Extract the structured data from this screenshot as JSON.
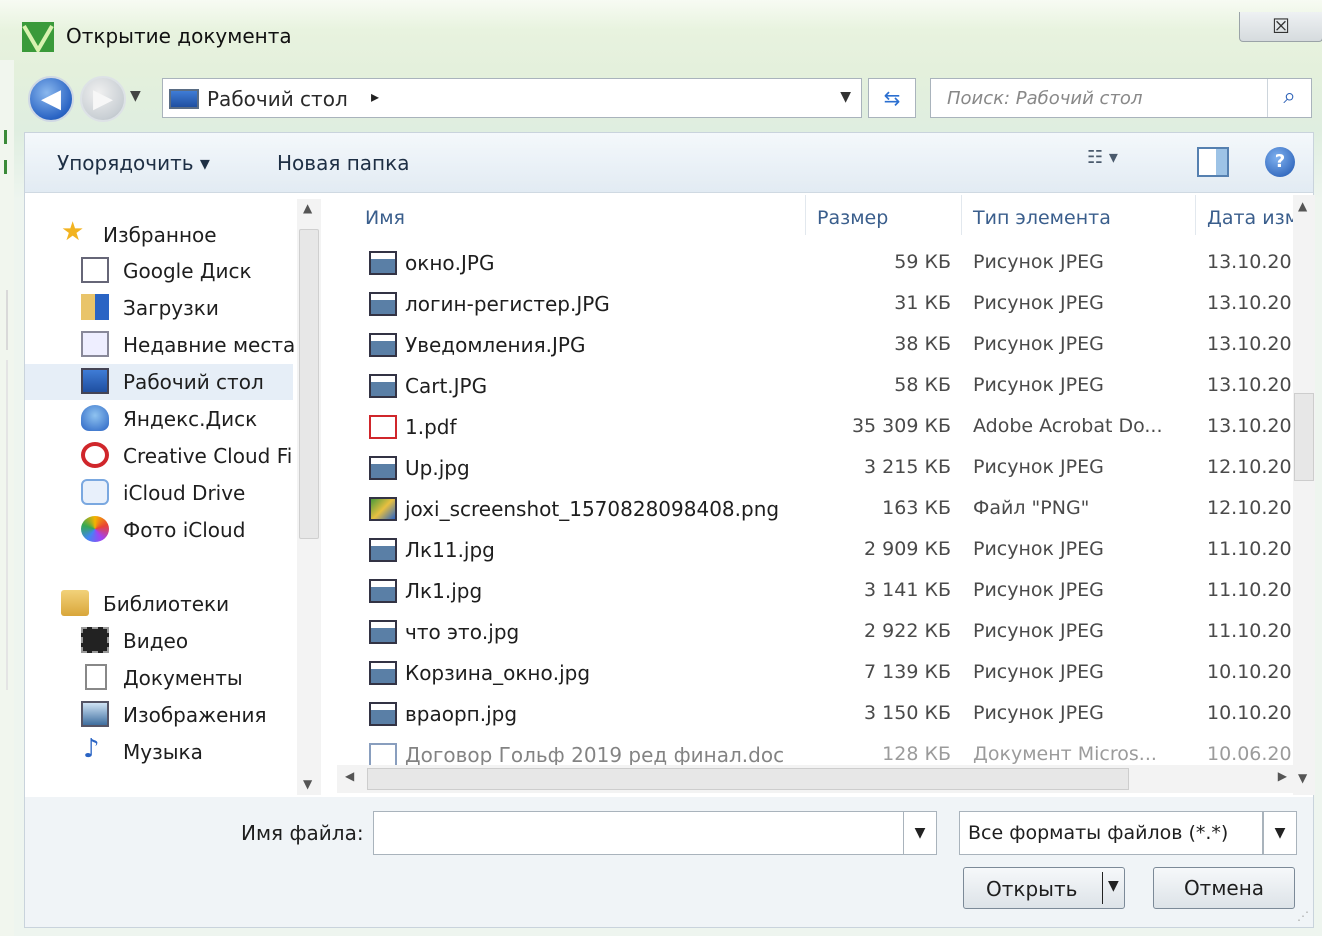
{
  "window": {
    "title": "Открытие документа",
    "close_glyph": "☒"
  },
  "nav": {
    "back_icon": "back-arrow-icon",
    "forward_icon": "forward-arrow-icon",
    "location": "Рабочий стол",
    "location_chevron": "▸",
    "search_placeholder": "Поиск: Рабочий стол"
  },
  "toolbar": {
    "organize_label": "Упорядочить ▾",
    "new_folder_label": "Новая папка",
    "view_glyph": "☷ ▾",
    "help_glyph": "?"
  },
  "sidebar": {
    "favorites_label": "Избранное",
    "items": [
      {
        "label": "Google Диск",
        "icon": "google-drive-icon"
      },
      {
        "label": "Загрузки",
        "icon": "downloads-icon"
      },
      {
        "label": "Недавние места",
        "icon": "recent-places-icon"
      },
      {
        "label": "Рабочий стол",
        "icon": "desktop-icon",
        "selected": true
      },
      {
        "label": "Яндекс.Диск",
        "icon": "yandex-disk-icon"
      },
      {
        "label": "Creative Cloud Fi",
        "icon": "creative-cloud-icon"
      },
      {
        "label": "iCloud Drive",
        "icon": "icloud-drive-icon"
      },
      {
        "label": "Фото iCloud",
        "icon": "icloud-photos-icon"
      }
    ],
    "libraries_label": "Библиотеки",
    "library_items": [
      {
        "label": "Видео",
        "icon": "video-icon"
      },
      {
        "label": "Документы",
        "icon": "documents-icon"
      },
      {
        "label": "Изображения",
        "icon": "pictures-icon"
      },
      {
        "label": "Музыка",
        "icon": "music-icon"
      }
    ]
  },
  "columns": {
    "name": "Имя",
    "size": "Размер",
    "type": "Тип элемента",
    "date": "Дата изм"
  },
  "files": [
    {
      "name": "окно.JPG",
      "size": "59 КБ",
      "type": "Рисунок JPEG",
      "date": "13.10.20",
      "kind": "jpg"
    },
    {
      "name": "логин-регистер.JPG",
      "size": "31 КБ",
      "type": "Рисунок JPEG",
      "date": "13.10.20",
      "kind": "jpg"
    },
    {
      "name": "Уведомления.JPG",
      "size": "38 КБ",
      "type": "Рисунок JPEG",
      "date": "13.10.20",
      "kind": "jpg"
    },
    {
      "name": "Cart.JPG",
      "size": "58 КБ",
      "type": "Рисунок JPEG",
      "date": "13.10.20",
      "kind": "jpg"
    },
    {
      "name": "1.pdf",
      "size": "35 309 КБ",
      "type": "Adobe Acrobat Do...",
      "date": "13.10.20",
      "kind": "pdf"
    },
    {
      "name": "Up.jpg",
      "size": "3 215 КБ",
      "type": "Рисунок JPEG",
      "date": "12.10.20",
      "kind": "jpg"
    },
    {
      "name": "joxi_screenshot_1570828098408.png",
      "size": "163 КБ",
      "type": "Файл \"PNG\"",
      "date": "12.10.20",
      "kind": "png"
    },
    {
      "name": "Лк11.jpg",
      "size": "2 909 КБ",
      "type": "Рисунок JPEG",
      "date": "11.10.20",
      "kind": "jpg"
    },
    {
      "name": "Лк1.jpg",
      "size": "3 141 КБ",
      "type": "Рисунок JPEG",
      "date": "11.10.20",
      "kind": "jpg"
    },
    {
      "name": "что это.jpg",
      "size": "2 922 КБ",
      "type": "Рисунок JPEG",
      "date": "11.10.20",
      "kind": "jpg"
    },
    {
      "name": "Корзина_окно.jpg",
      "size": "7 139 КБ",
      "type": "Рисунок JPEG",
      "date": "10.10.20",
      "kind": "jpg"
    },
    {
      "name": "враорп.jpg",
      "size": "3 150 КБ",
      "type": "Рисунок JPEG",
      "date": "10.10.20",
      "kind": "jpg"
    },
    {
      "name": "Договор Гольф 2019 ред финал.doc",
      "size": "128 КБ",
      "type": "Документ Micros...",
      "date": "10.06.20",
      "kind": "doc"
    }
  ],
  "footer": {
    "filename_label": "Имя файла:",
    "filename_value": "",
    "filter_value": "Все форматы файлов (*.*)",
    "open_label": "Открыть",
    "cancel_label": "Отмена"
  },
  "colors": {
    "accent": "#2a64c4",
    "header_text": "#3a5e8c",
    "title_bg": "#e8f3df"
  }
}
